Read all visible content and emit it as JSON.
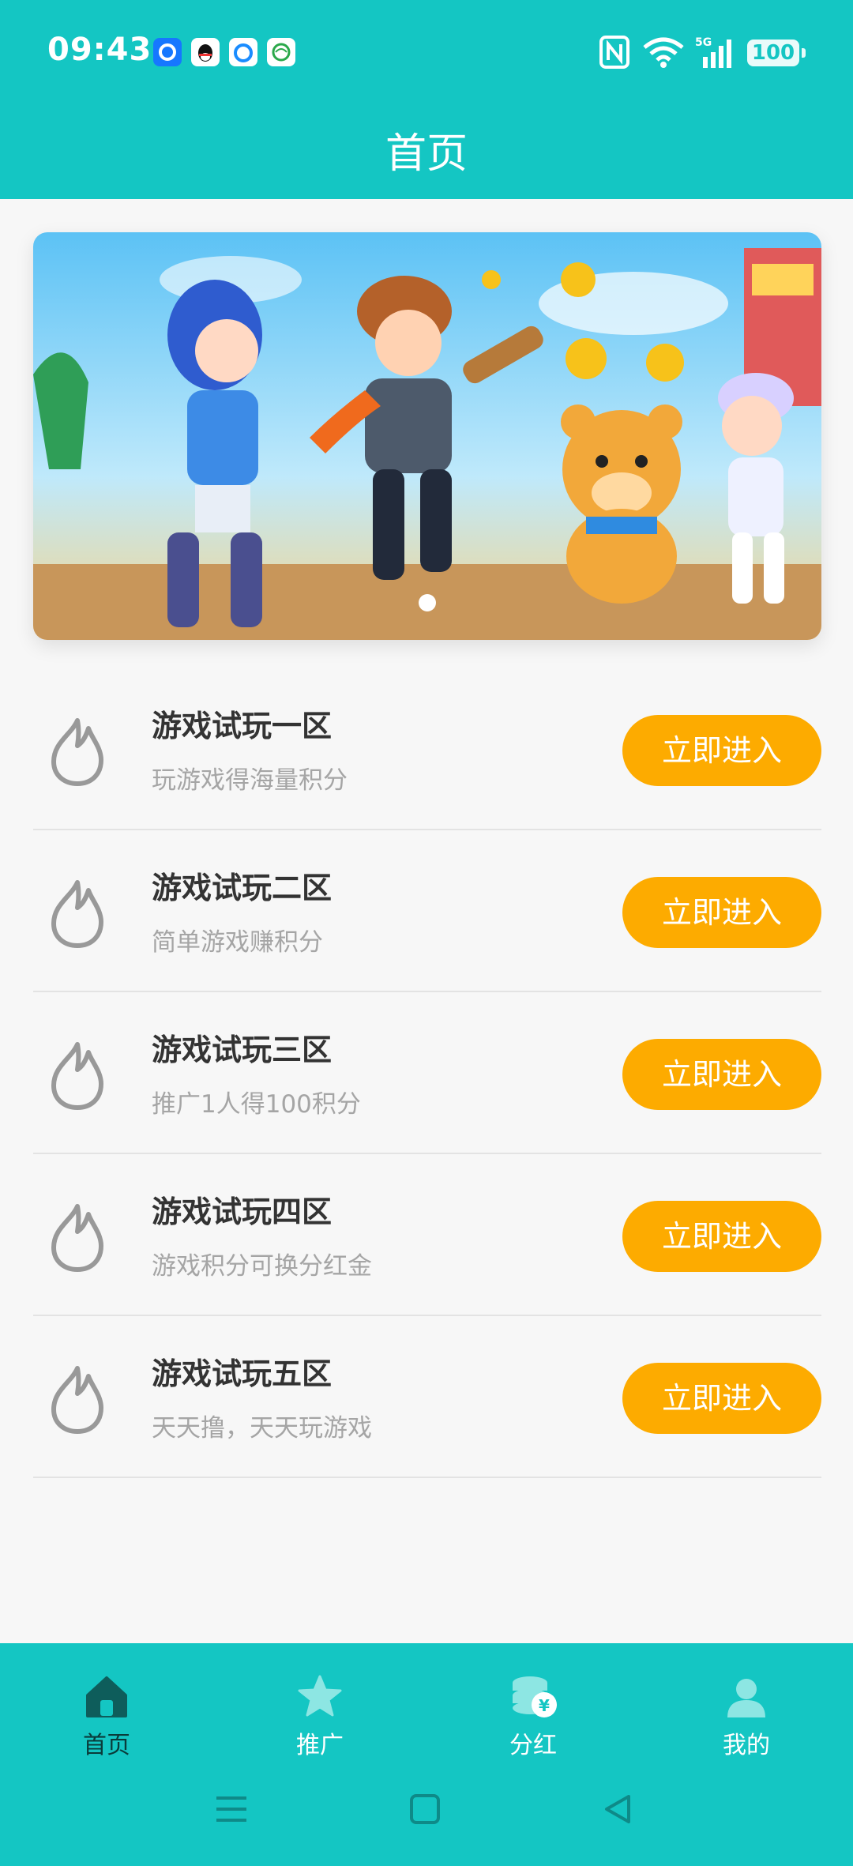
{
  "status_bar": {
    "time": "09:43",
    "battery": "100"
  },
  "header": {
    "title": "首页"
  },
  "banner": {
    "slide_index": 1,
    "slide_count": 1
  },
  "zones": [
    {
      "name": "游戏试玩一区",
      "desc": "玩游戏得海量积分",
      "button": "立即进入"
    },
    {
      "name": "游戏试玩二区",
      "desc": "简单游戏赚积分",
      "button": "立即进入"
    },
    {
      "name": "游戏试玩三区",
      "desc": "推广1人得100积分",
      "button": "立即进入"
    },
    {
      "name": "游戏试玩四区",
      "desc": "游戏积分可换分红金",
      "button": "立即进入"
    },
    {
      "name": "游戏试玩五区",
      "desc": "天天撸，天天玩游戏",
      "button": "立即进入"
    }
  ],
  "tabbar": {
    "tabs": [
      {
        "label": "首页",
        "icon": "home-icon",
        "active": true
      },
      {
        "label": "推广",
        "icon": "star-icon",
        "active": false
      },
      {
        "label": "分红",
        "icon": "coins-yuan-icon",
        "active": false
      },
      {
        "label": "我的",
        "icon": "user-icon",
        "active": false
      }
    ]
  },
  "colors": {
    "primary": "#14c6c3",
    "button": "#fdab00",
    "background": "#f7f7f7"
  }
}
